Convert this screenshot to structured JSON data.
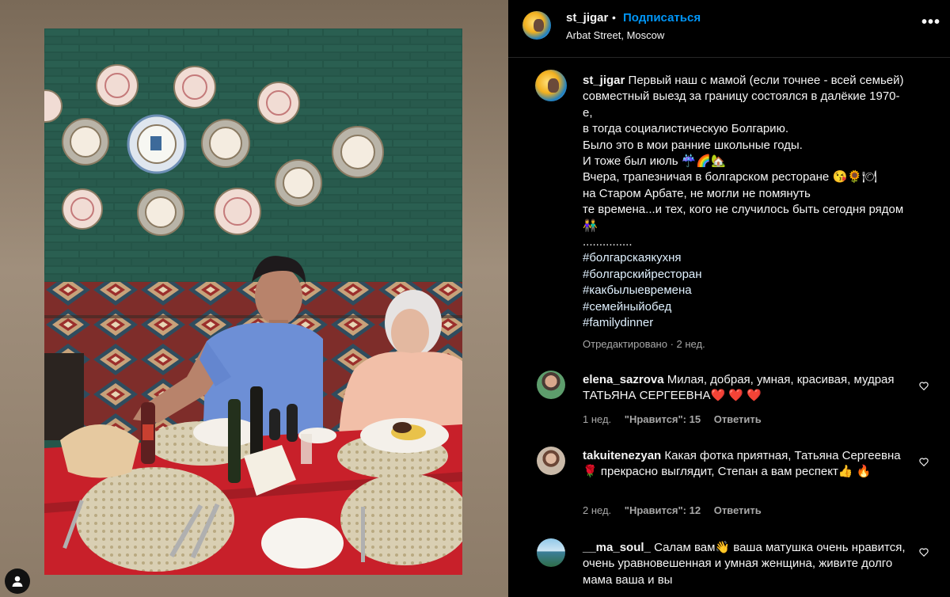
{
  "post": {
    "username": "st_jigar",
    "follow_label": "Подписаться",
    "separator": "•",
    "location": "Arbat Street, Moscow",
    "more_label": "•••"
  },
  "caption": {
    "username": "st_jigar",
    "lines": [
      "Первый наш с мамой (если точнее - всей семьей)",
      "совместный выезд за границу состоялся в далёкие 1970-",
      "е,",
      "в тогда социалистическую Болгарию.",
      "Было это в мои ранние школьные годы.",
      "И тоже был июль ☔🌈🏡",
      "Вчера, трапезничая в болгарском ресторане 😘🌻🍽",
      "на Старом Арбате, не могли не помянуть",
      "те времена...и тех, кого не случилось быть сегодня рядом",
      "👫",
      "..............."
    ],
    "hashtags": [
      "#болгарскаякухня",
      "#болгарскийресторан",
      "#какбылыевремена",
      "#семейныйобед",
      "#familydinner"
    ],
    "meta": "Отредактировано · 2 нед."
  },
  "comments": [
    {
      "username": "elena_sazrova",
      "text": "Милая, добрая, умная, красивая, мудрая ТАТЬЯНА СЕРГЕЕВНА❤️ ❤️ ❤️",
      "time": "1 нед.",
      "likes": "\"Нравится\": 15",
      "reply": "Ответить"
    },
    {
      "username": "takuitenezyan",
      "text": "Какая фотка приятная, Татьяна Сергеевна🌹 прекрасно выглядит, Степан а вам респект👍 🔥",
      "time": "2 нед.",
      "likes": "\"Нравится\": 12",
      "reply": "Ответить"
    },
    {
      "username": "__ma_soul_",
      "text": "Салам вам👋 ваша матушка очень нравится, очень уравновешенная и умная женщина, живите долго мама ваша и вы",
      "time": "",
      "likes": "",
      "reply": ""
    }
  ],
  "colors": {
    "accent": "#0095f6",
    "background": "#000000",
    "muted_text": "#a8a8a8",
    "wall_green": "#25564a",
    "tablecloth_red": "#c8202a"
  },
  "icons": {
    "more": "more-horizontal-icon",
    "like": "heart-outline-icon",
    "profile": "user-silhouette-icon"
  }
}
